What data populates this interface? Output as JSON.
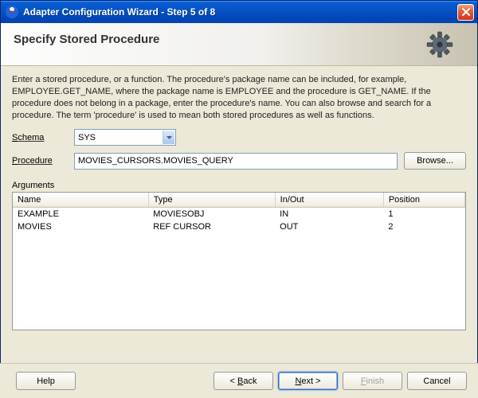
{
  "window": {
    "title": "Adapter Configuration Wizard - Step 5 of 8"
  },
  "banner": {
    "heading": "Specify Stored Procedure"
  },
  "instructions": "Enter a stored procedure, or a function. The procedure's package name can be included, for example, EMPLOYEE.GET_NAME, where the package name is EMPLOYEE and the procedure is GET_NAME.  If the procedure does not belong in a package, enter the procedure's name. You can also browse and search for a procedure. The term 'procedure' is used to mean both stored procedures as well as functions.",
  "form": {
    "schema_label": "Schema",
    "schema_value": "SYS",
    "procedure_label": "Procedure",
    "procedure_value": "MOVIES_CURSORS.MOVIES_QUERY",
    "browse_label": "Browse..."
  },
  "arguments": {
    "label": "Arguments",
    "columns": {
      "name": "Name",
      "type": "Type",
      "inout": "In/Out",
      "position": "Position"
    },
    "rows": [
      {
        "name": "EXAMPLE",
        "type": "MOVIESOBJ",
        "inout": "IN",
        "position": "1"
      },
      {
        "name": "MOVIES",
        "type": "REF CURSOR",
        "inout": "OUT",
        "position": "2"
      }
    ]
  },
  "footer": {
    "help": "Help",
    "back": "< Back",
    "next": "Next >",
    "finish": "Finish",
    "cancel": "Cancel"
  }
}
